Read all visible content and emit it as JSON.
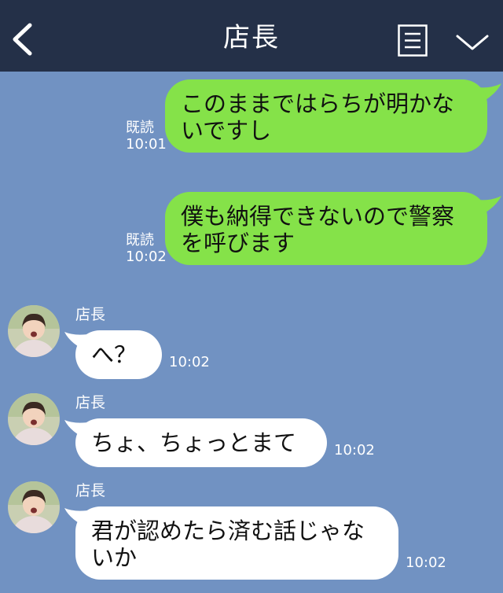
{
  "header": {
    "title": "店長",
    "back_icon": "chevron-left-icon",
    "menu_icon": "notes-icon",
    "dropdown_icon": "chevron-down-icon",
    "bg_color": "#243048"
  },
  "chat": {
    "bg_color": "#7192c2",
    "outgoing_color": "#85e249",
    "incoming_color": "#ffffff",
    "messages": [
      {
        "direction": "out",
        "lines": [
          "このままではらちが明かな",
          "いですし"
        ],
        "status": "既読",
        "time": "10:01"
      },
      {
        "direction": "out",
        "lines": [
          "僕も納得できないので警察",
          "を呼びます"
        ],
        "status": "既読",
        "time": "10:02"
      },
      {
        "direction": "in",
        "sender": "店長",
        "lines": [
          "へ？"
        ],
        "time": "10:02"
      },
      {
        "direction": "in",
        "sender": "店長",
        "lines": [
          "ちょ、ちょっとまて"
        ],
        "time": "10:02"
      },
      {
        "direction": "in",
        "sender": "店長",
        "lines": [
          "君が認めたら済む話じゃな",
          "いか"
        ],
        "time": "10:02"
      }
    ]
  }
}
